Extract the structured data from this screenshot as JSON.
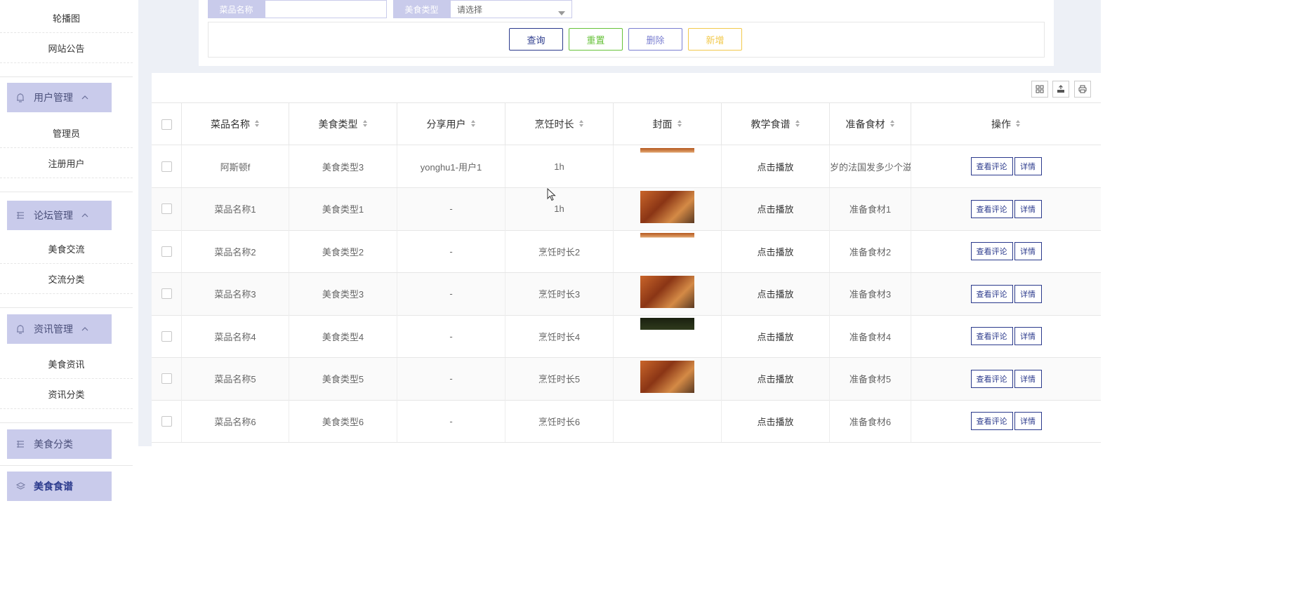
{
  "sidebar": {
    "top_items": [
      {
        "label": "轮播图"
      },
      {
        "label": "网站公告"
      }
    ],
    "groups": [
      {
        "title": "用户管理",
        "icon": "bell-icon",
        "items": [
          {
            "label": "管理员"
          },
          {
            "label": "注册用户"
          }
        ]
      },
      {
        "title": "论坛管理",
        "icon": "list-icon",
        "items": [
          {
            "label": "美食交流"
          },
          {
            "label": "交流分类"
          }
        ]
      },
      {
        "title": "资讯管理",
        "icon": "bell-icon",
        "items": [
          {
            "label": "美食资讯"
          },
          {
            "label": "资讯分类"
          }
        ]
      },
      {
        "title": "美食分类",
        "icon": "list-icon",
        "items": []
      },
      {
        "title": "美食食谱",
        "icon": "layers-icon",
        "items": [],
        "active": true
      }
    ]
  },
  "search": {
    "name_label": "菜品名称",
    "name_value": "",
    "type_label": "美食类型",
    "type_placeholder": "请选择",
    "buttons": {
      "query": "查询",
      "reset": "重置",
      "delete": "删除",
      "add": "新增"
    },
    "button_colors": {
      "query": "#2b3a8c",
      "reset": "#67c23a",
      "delete": "#7b7fd1",
      "add": "#f2c94c"
    }
  },
  "toolbar_icons": [
    "grid-icon",
    "export-icon",
    "print-icon"
  ],
  "table": {
    "columns": [
      "菜品名称",
      "美食类型",
      "分享用户",
      "烹饪时长",
      "封面",
      "教学食谱",
      "准备食材",
      "操作"
    ],
    "rows": [
      {
        "name": "阿斯顿f",
        "type": "美食类型3",
        "user": "yonghu1-用户1",
        "duration": "1h",
        "cover": "partial",
        "recipe": "点击播放",
        "ingredients": "岁的法国发多少个滋"
      },
      {
        "name": "菜品名称1",
        "type": "美食类型1",
        "user": "-",
        "duration": "1h",
        "cover": "full",
        "recipe": "点击播放",
        "ingredients": "准备食材1"
      },
      {
        "name": "菜品名称2",
        "type": "美食类型2",
        "user": "-",
        "duration": "烹饪时长2",
        "cover": "partial",
        "recipe": "点击播放",
        "ingredients": "准备食材2"
      },
      {
        "name": "菜品名称3",
        "type": "美食类型3",
        "user": "-",
        "duration": "烹饪时长3",
        "cover": "full",
        "recipe": "点击播放",
        "ingredients": "准备食材3"
      },
      {
        "name": "菜品名称4",
        "type": "美食类型4",
        "user": "-",
        "duration": "烹饪时长4",
        "cover": "partial-dark",
        "recipe": "点击播放",
        "ingredients": "准备食材4"
      },
      {
        "name": "菜品名称5",
        "type": "美食类型5",
        "user": "-",
        "duration": "烹饪时长5",
        "cover": "full",
        "recipe": "点击播放",
        "ingredients": "准备食材5"
      },
      {
        "name": "菜品名称6",
        "type": "美食类型6",
        "user": "-",
        "duration": "烹饪时长6",
        "cover": "none",
        "recipe": "点击播放",
        "ingredients": "准备食材6"
      }
    ],
    "row_actions": {
      "comments": "查看评论",
      "detail": "详情"
    }
  }
}
